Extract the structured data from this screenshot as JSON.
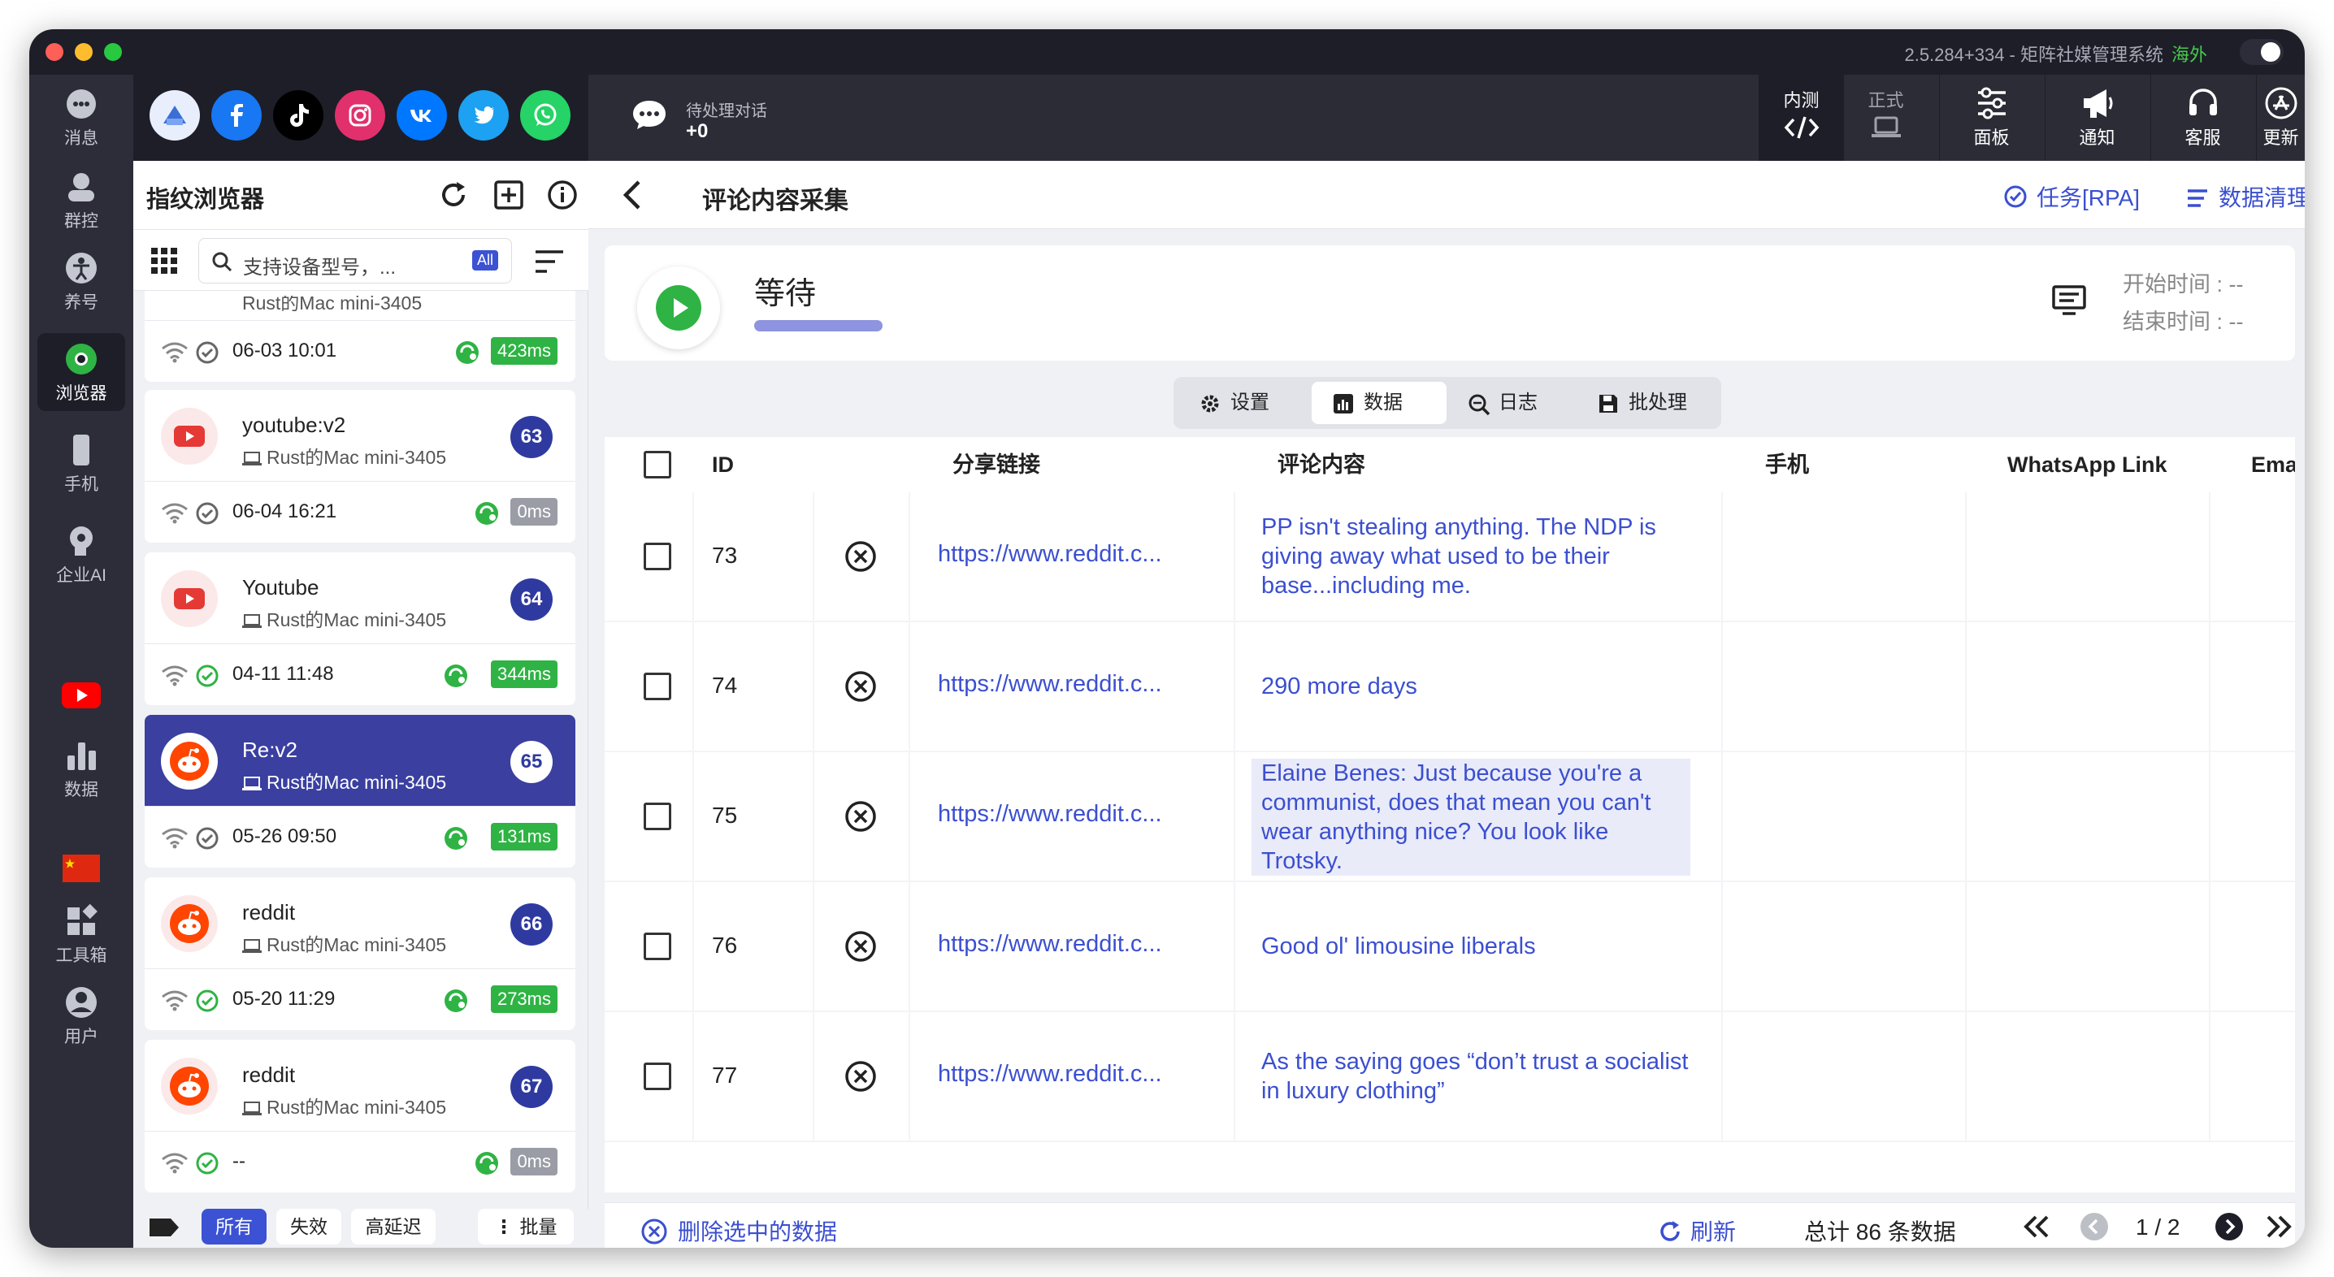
{
  "window": {
    "title": "2.5.284+334 - 矩阵社媒管理系统",
    "region": "海外"
  },
  "leftnav": {
    "items": [
      {
        "label": "消息",
        "icon": "message-icon"
      },
      {
        "label": "群控",
        "icon": "group-control-icon"
      },
      {
        "label": "养号",
        "icon": "account-nurture-icon"
      },
      {
        "label": "浏览器",
        "icon": "browser-icon",
        "active": true
      },
      {
        "label": "手机",
        "icon": "phone-icon"
      },
      {
        "label": "企业AI",
        "icon": "ai-icon"
      },
      {
        "label": "数据",
        "icon": "data-icon"
      },
      {
        "label": "工具箱",
        "icon": "toolbox-icon"
      },
      {
        "label": "用户",
        "icon": "user-icon"
      }
    ]
  },
  "social_icons": [
    "browser-icon",
    "facebook-icon",
    "tiktok-icon",
    "instagram-icon",
    "vk-icon",
    "twitter-icon",
    "whatsapp-icon"
  ],
  "topbar": {
    "pending_label": "待处理对话",
    "pending_count": "+0",
    "buttons": {
      "beta": "内测",
      "prod": "正式",
      "panel": "面板",
      "notify": "通知",
      "service": "客服",
      "update": "更新"
    }
  },
  "sidebar": {
    "title": "指纹浏览器",
    "search_placeholder": "支持设备型号，...",
    "search_badge": "All",
    "partial_top": {
      "device": "Rust的Mac mini-3405",
      "time": "06-03 10:01",
      "latency": "423ms"
    },
    "cards": [
      {
        "name": "youtube:v2",
        "device": "Rust的Mac mini-3405",
        "num": "63",
        "time": "06-04 16:21",
        "latency": "0ms",
        "platform": "youtube"
      },
      {
        "name": "Youtube",
        "device": "Rust的Mac mini-3405",
        "num": "64",
        "time": "04-11 11:48",
        "latency": "344ms",
        "platform": "youtube"
      },
      {
        "name": "Re:v2",
        "device": "Rust的Mac mini-3405",
        "num": "65",
        "time": "05-26 09:50",
        "latency": "131ms",
        "platform": "reddit",
        "active": true
      },
      {
        "name": "reddit",
        "device": "Rust的Mac mini-3405",
        "num": "66",
        "time": "05-20 11:29",
        "latency": "273ms",
        "platform": "reddit"
      },
      {
        "name": "reddit",
        "device": "Rust的Mac mini-3405",
        "num": "67",
        "time": "--",
        "latency": "0ms",
        "platform": "reddit"
      }
    ],
    "footer": {
      "all": "所有",
      "invalid": "失效",
      "high_latency": "高延迟",
      "batch": "批量"
    }
  },
  "main": {
    "title": "评论内容采集",
    "task_link": "任务[RPA]",
    "clean_link": "数据清理",
    "status": {
      "state": "等待",
      "start_label": "开始时间 : --",
      "end_label": "结束时间 : --"
    },
    "tabs": {
      "settings": "设置",
      "data": "数据",
      "log": "日志",
      "batch": "批处理"
    },
    "columns": {
      "id": "ID",
      "share": "分享链接",
      "comment": "评论内容",
      "phone": "手机",
      "whatsapp": "WhatsApp Link",
      "email": "Email"
    },
    "rows": [
      {
        "id": "73",
        "link": "https://www.reddit.c...",
        "comment": "PP isn't stealing anything. The NDP is giving away what used to be their base...including me."
      },
      {
        "id": "74",
        "link": "https://www.reddit.c...",
        "comment": "290 more days"
      },
      {
        "id": "75",
        "link": "https://www.reddit.c...",
        "comment": "Elaine Benes: Just because you're a communist, does that mean you can't wear anything nice? You look like Trotsky."
      },
      {
        "id": "76",
        "link": "https://www.reddit.c...",
        "comment": "Good ol' limousine liberals"
      },
      {
        "id": "77",
        "link": "https://www.reddit.c...",
        "comment": "As the saying goes “don’t trust a socialist in luxury clothing”"
      }
    ],
    "footer": {
      "delete": "删除选中的数据",
      "refresh": "刷新",
      "total": "总计 86 条数据",
      "page": "1 / 2"
    }
  },
  "colors": {
    "accent": "#3b4fd0",
    "dark": "#1d1e28",
    "green": "#2fb344",
    "active_card": "#3a3fa0"
  }
}
